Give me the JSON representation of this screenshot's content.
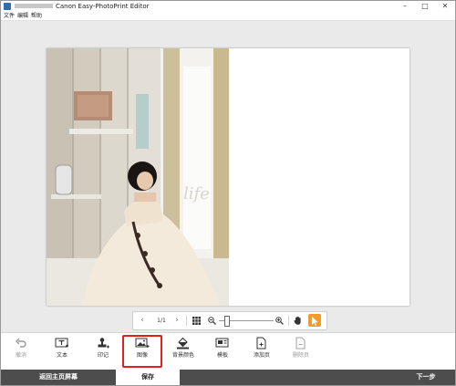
{
  "window": {
    "title": "Canon Easy-PhotoPrint Editor",
    "controls": [
      "–",
      "□",
      "✕"
    ]
  },
  "menu": [
    "文件",
    "编辑",
    "帮助"
  ],
  "navbar": {
    "page_indicator": "1/1"
  },
  "toolbar": {
    "items": [
      {
        "label": "撤消",
        "icon": "undo-icon",
        "enabled": false
      },
      {
        "label": "文本",
        "icon": "text-icon",
        "enabled": true
      },
      {
        "label": "印记",
        "icon": "stamp-icon",
        "enabled": true
      },
      {
        "label": "图像",
        "icon": "image-icon",
        "enabled": true,
        "highlighted": true
      },
      {
        "label": "背景颜色",
        "icon": "background-color-icon",
        "enabled": true
      },
      {
        "label": "模板",
        "icon": "template-icon",
        "enabled": true
      },
      {
        "label": "添加页",
        "icon": "add-page-icon",
        "enabled": true
      },
      {
        "label": "删除页",
        "icon": "delete-page-icon",
        "enabled": false
      }
    ]
  },
  "bottom": {
    "home_label": "返回主页屏幕",
    "save_label": "保存",
    "next_label": "下一步"
  },
  "photo": {
    "overlay_text": "life"
  },
  "colors": {
    "accent": "#f39a2b",
    "highlight": "#e0201a",
    "bottom_bar": "#4d4d4d"
  }
}
